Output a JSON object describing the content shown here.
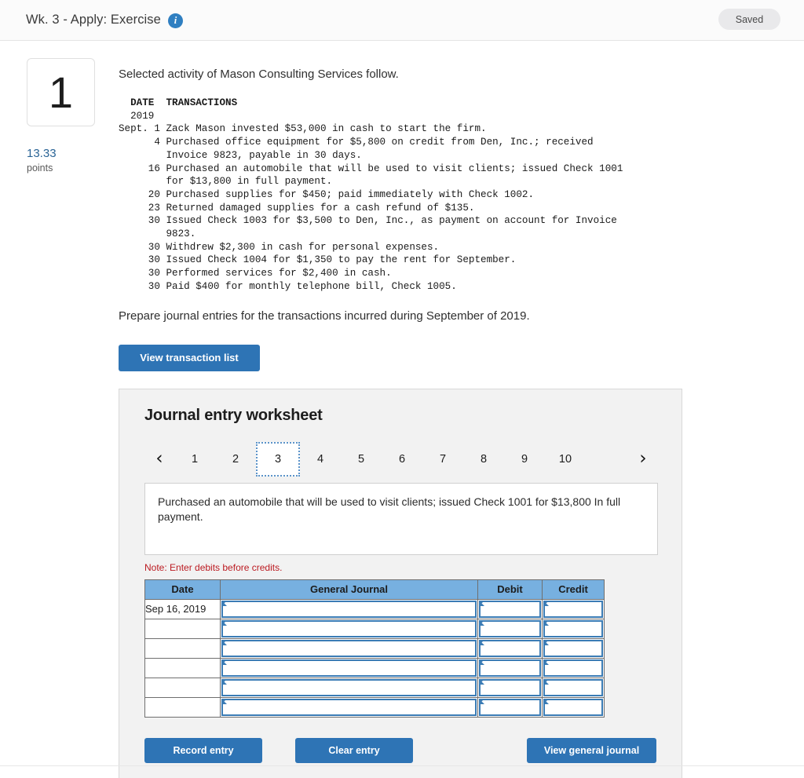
{
  "header": {
    "title": "Wk. 3 - Apply: Exercise",
    "info_icon": "info-icon",
    "saved_label": "Saved"
  },
  "question": {
    "number": "1",
    "points_value": "13.33",
    "points_label": "points"
  },
  "problem": {
    "lead": "Selected activity of Mason Consulting Services follow.",
    "table_header_date": "DATE",
    "table_header_transactions": "TRANSACTIONS",
    "year": "2019",
    "lines": [
      "Sept. 1 Zack Mason invested $53,000 in cash to start the firm.",
      "      4 Purchased office equipment for $5,800 on credit from Den, Inc.; received",
      "        Invoice 9823, payable in 30 days.",
      "     16 Purchased an automobile that will be used to visit clients; issued Check 1001",
      "        for $13,800 in full payment.",
      "     20 Purchased supplies for $450; paid immediately with Check 1002.",
      "     23 Returned damaged supplies for a cash refund of $135.",
      "     30 Issued Check 1003 for $3,500 to Den, Inc., as payment on account for Invoice",
      "        9823.",
      "     30 Withdrew $2,300 in cash for personal expenses.",
      "     30 Issued Check 1004 for $1,350 to pay the rent for September.",
      "     30 Performed services for $2,400 in cash.",
      "     30 Paid $400 for monthly telephone bill, Check 1005."
    ],
    "prepare": "Prepare journal entries for the transactions incurred during September of 2019."
  },
  "buttons": {
    "view_transaction_list": "View transaction list",
    "record_entry": "Record entry",
    "clear_entry": "Clear entry",
    "view_general_journal": "View general journal"
  },
  "worksheet": {
    "title": "Journal entry worksheet",
    "prev_arrow": "‹",
    "next_arrow": "›",
    "pages": [
      "1",
      "2",
      "3",
      "4",
      "5",
      "6",
      "7",
      "8",
      "9",
      "10"
    ],
    "active_page": "3",
    "description": "Purchased an automobile that will be used to visit clients; issued Check 1001 for $13,800 In full payment.",
    "note": "Note: Enter debits before credits.",
    "columns": [
      "Date",
      "General Journal",
      "Debit",
      "Credit"
    ],
    "rows": [
      {
        "date": "Sep 16, 2019",
        "general_journal": "",
        "debit": "",
        "credit": ""
      },
      {
        "date": "",
        "general_journal": "",
        "debit": "",
        "credit": ""
      },
      {
        "date": "",
        "general_journal": "",
        "debit": "",
        "credit": ""
      },
      {
        "date": "",
        "general_journal": "",
        "debit": "",
        "credit": ""
      },
      {
        "date": "",
        "general_journal": "",
        "debit": "",
        "credit": ""
      },
      {
        "date": "",
        "general_journal": "",
        "debit": "",
        "credit": ""
      }
    ]
  },
  "colors": {
    "accent_blue": "#2e74b5",
    "table_header_blue": "#77b0e0",
    "cell_border_blue": "#3b7cb5",
    "note_red": "#bb1a21",
    "points_blue": "#2a6496"
  }
}
